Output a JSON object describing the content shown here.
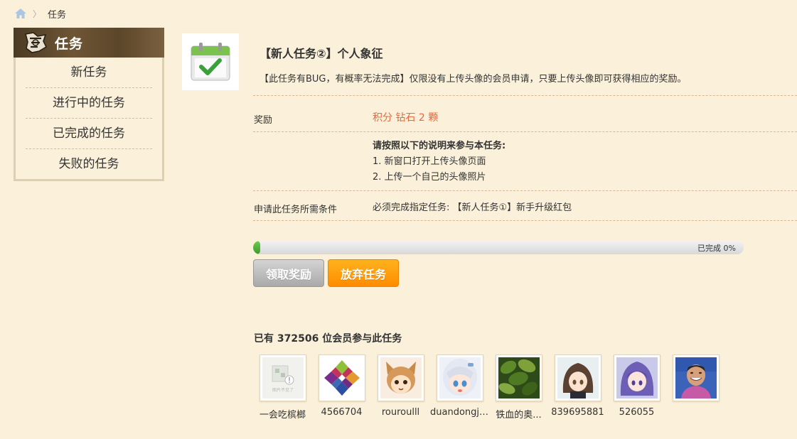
{
  "breadcrumb": {
    "current": "任务"
  },
  "sidebar": {
    "title": "任务",
    "items": [
      {
        "label": "新任务"
      },
      {
        "label": "进行中的任务"
      },
      {
        "label": "已完成的任务"
      },
      {
        "label": "失败的任务"
      }
    ]
  },
  "task": {
    "title": "【新人任务②】个人象征",
    "description": "【此任务有BUG，有概率无法完成】仅限没有上传头像的会员申请，只要上传头像即可获得相应的奖励。",
    "reward_label": "奖励",
    "reward_value": "积分 钻石 2 颗",
    "instructions_heading": "请按照以下的说明来参与本任务:",
    "instructions": [
      "1. 新窗口打开上传头像页面",
      "2. 上传一个自己的头像照片"
    ],
    "condition_label": "申请此任务所需条件",
    "condition_value": "必须完成指定任务: 【新人任务①】新手升级红包"
  },
  "progress": {
    "percent": 0,
    "text": "已完成 0%"
  },
  "buttons": {
    "claim": "领取奖励",
    "abandon": "放弃任务"
  },
  "participants": {
    "text": "已有 372506 位会员参与此任务"
  },
  "members": [
    {
      "name": "一会吃槟榔",
      "avatar": "broken-image-placeholder",
      "placeholder_text": "图片不见了"
    },
    {
      "name": "4566704",
      "avatar": "colorful-geometric-logo"
    },
    {
      "name": "rouroulll",
      "avatar": "anime-fox-girl"
    },
    {
      "name": "duandongjiemcyutingli...",
      "avatar": "anime-white-hair-girl"
    },
    {
      "name": "铁血的奥...",
      "avatar": "green-leaves"
    },
    {
      "name": "839695881",
      "avatar": "anime-brown-hair-girl"
    },
    {
      "name": "526055",
      "avatar": "anime-purple-hair-girl"
    },
    {
      "name": "",
      "avatar": "smiling-man-photo"
    }
  ],
  "colors": {
    "accent_orange": "#ff8c00",
    "reward_text": "#e66a3f",
    "background": "#fbf1da"
  }
}
